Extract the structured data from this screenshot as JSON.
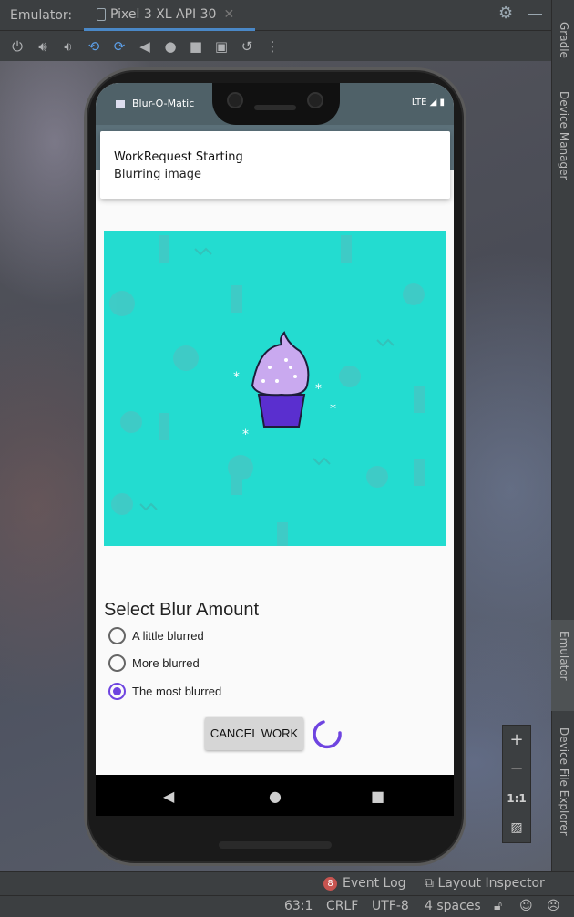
{
  "ide": {
    "panel_title": "Emulator:",
    "device_tab": "Pixel 3 XL API 30",
    "tab_close": "✕",
    "side_labels": [
      "Gradle",
      "Device Manager",
      "Emulator",
      "Device File Explorer"
    ],
    "zoom": {
      "plus": "+",
      "minus": "−",
      "one_to_one": "1:1"
    },
    "event_log": {
      "count": "8",
      "label": "Event Log"
    },
    "layout_inspector": "Layout Inspector",
    "status": {
      "position": "63:1",
      "line_sep": "CRLF",
      "encoding": "UTF-8",
      "indent": "4 spaces"
    }
  },
  "phone": {
    "app_name": "Blur-O-Matic",
    "network": "LTE",
    "notification": {
      "title": "WorkRequest Starting",
      "text": "Blurring image"
    },
    "blur_title": "Select Blur Amount",
    "options": [
      {
        "label": "A little blurred",
        "checked": false
      },
      {
        "label": "More blurred",
        "checked": false
      },
      {
        "label": "The most blurred",
        "checked": true
      }
    ],
    "cancel_button": "CANCEL WORK"
  },
  "colors": {
    "accent": "#6e44e0",
    "image_bg": "#23dcd0",
    "appbar": "#5b7079"
  }
}
